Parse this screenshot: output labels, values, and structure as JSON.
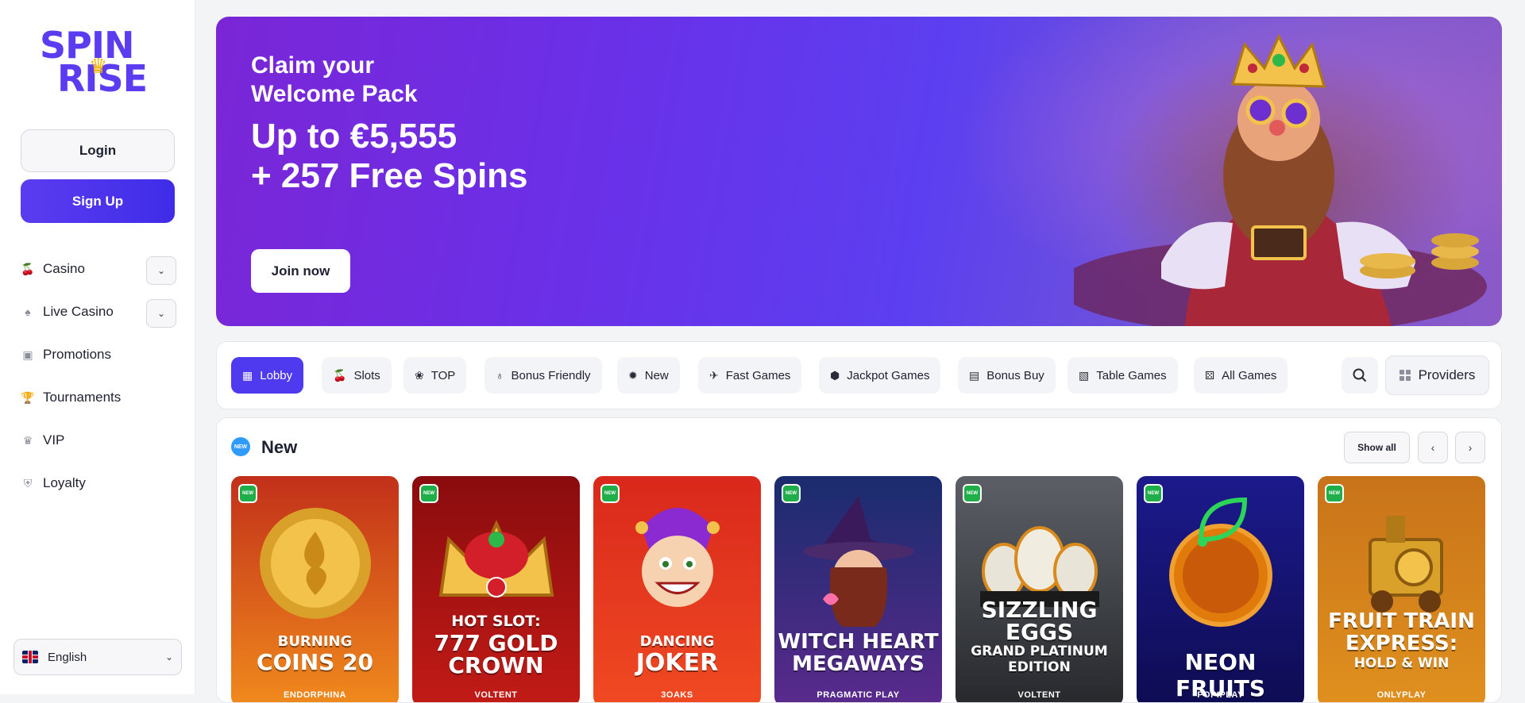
{
  "sidebar": {
    "logo_line1": "SPIN",
    "logo_line2": "RISE",
    "login_label": "Login",
    "signup_label": "Sign Up",
    "nav": [
      {
        "label": "Casino",
        "icon": "cherries-icon",
        "has_dropdown": true
      },
      {
        "label": "Live Casino",
        "icon": "spade-icon",
        "has_dropdown": true
      },
      {
        "label": "Promotions",
        "icon": "gift-icon",
        "has_dropdown": false
      },
      {
        "label": "Tournaments",
        "icon": "trophy-icon",
        "has_dropdown": false
      },
      {
        "label": "VIP",
        "icon": "crown-icon",
        "has_dropdown": false
      },
      {
        "label": "Loyalty",
        "icon": "shield-icon",
        "has_dropdown": false
      }
    ],
    "language": "English"
  },
  "banner": {
    "claim_line1": "Claim your",
    "claim_line2": "Welcome Pack",
    "amount_line1": "Up to €5,555",
    "amount_line2": "+ 257 Free Spins",
    "cta_label": "Join now"
  },
  "categories": {
    "items": [
      {
        "label": "Lobby",
        "icon": "grid-icon",
        "active": true
      },
      {
        "label": "Slots",
        "icon": "cherries-icon",
        "active": false
      },
      {
        "label": "TOP",
        "icon": "medal-icon",
        "active": false
      },
      {
        "label": "Bonus Friendly",
        "icon": "money-bag-icon",
        "active": false
      },
      {
        "label": "New",
        "icon": "new-badge-icon",
        "active": false
      },
      {
        "label": "Fast Games",
        "icon": "plane-icon",
        "active": false
      },
      {
        "label": "Jackpot Games",
        "icon": "jackpot-icon",
        "active": false
      },
      {
        "label": "Bonus Buy",
        "icon": "basket-icon",
        "active": false
      },
      {
        "label": "Table Games",
        "icon": "cards-icon",
        "active": false
      },
      {
        "label": "All Games",
        "icon": "dice-icon",
        "active": false
      }
    ],
    "providers_label": "Providers"
  },
  "new_section": {
    "title": "New",
    "badge": "NEW",
    "show_all_label": "Show all",
    "games": [
      {
        "title_line1": "BURNING",
        "title_line2": "COINS 20",
        "provider": "ENDORPHINA",
        "bg_top": "#c2301a",
        "bg_bottom": "#f08a1c"
      },
      {
        "title_line1": "HOT SLOT:",
        "title_line2": "777 GOLD",
        "title_line3": "CROWN",
        "provider": "VOLTENT",
        "bg_top": "#8a0c0e",
        "bg_bottom": "#c21b16"
      },
      {
        "title_line1": "DANCING",
        "title_line2": "JOKER",
        "provider": "3OAKS",
        "bg_top": "#d9281c",
        "bg_bottom": "#f04a22"
      },
      {
        "title_line1": "WITCH HEART",
        "title_line2": "MEGAWAYS",
        "provider": "PRAGMATIC PLAY",
        "bg_top": "#1a2c6e",
        "bg_bottom": "#5a2a8c"
      },
      {
        "title_line1": "SIZZLING",
        "title_line2": "EGGS",
        "title_line3": "GRAND PLATINUM",
        "title_line4": "EDITION",
        "provider": "VOLTENT",
        "bg_top": "#5c6066",
        "bg_bottom": "#26282c"
      },
      {
        "title_line1": "NEON FRUITS",
        "provider": "POPIPLAY",
        "bg_top": "#1c1a8c",
        "bg_bottom": "#0e0c52"
      },
      {
        "title_line1": "FRUIT TRAIN",
        "title_line2": "EXPRESS:",
        "title_line3": "HOLD & WIN",
        "provider": "ONLYPLAY",
        "bg_top": "#c8731a",
        "bg_bottom": "#e0901e"
      }
    ]
  },
  "colors": {
    "brand": "#5b3cf0",
    "accent": "#4f3af0",
    "badge_green": "#1fae4a",
    "badge_blue": "#2f9bff"
  }
}
